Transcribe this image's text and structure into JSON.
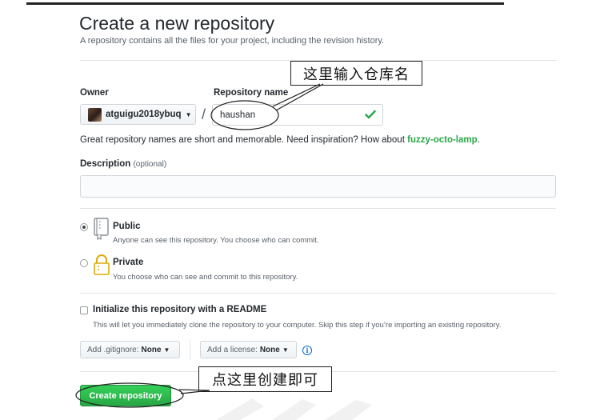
{
  "page": {
    "title": "Create a new repository",
    "subtitle": "A repository contains all the files for your project, including the revision history."
  },
  "owner": {
    "label": "Owner",
    "value": "atguigu2018ybuq"
  },
  "repo": {
    "label": "Repository name",
    "value": "haushan",
    "separator": "/"
  },
  "hint": {
    "text": "Great repository names are short and memorable. Need inspiration? How about ",
    "suggestion": "fuzzy-octo-lamp",
    "end": "."
  },
  "description": {
    "label": "Description",
    "optional": "(optional)",
    "value": ""
  },
  "visibility": {
    "public": {
      "title": "Public",
      "note": "Anyone can see this repository. You choose who can commit.",
      "selected": true
    },
    "private": {
      "title": "Private",
      "note": "You choose who can see and commit to this repository.",
      "selected": false
    }
  },
  "readme": {
    "title": "Initialize this repository with a README",
    "note": "This will let you immediately clone the repository to your computer. Skip this step if you’re importing an existing repository.",
    "checked": false
  },
  "gitignore": {
    "prefix": "Add .gitignore:",
    "value": "None"
  },
  "license": {
    "prefix": "Add a license:",
    "value": "None"
  },
  "submit": {
    "label": "Create repository"
  },
  "annotations": {
    "repo_name": "这里输入仓库名",
    "create": "点这里创建即可"
  },
  "colors": {
    "accent_green": "#28a745",
    "link_blue": "#0366d6",
    "check_green": "#28a745"
  },
  "icons": {
    "owner_dropdown": "caret-down-icon",
    "valid": "check-icon",
    "public": "repo-book-icon",
    "private": "lock-icon",
    "info": "info-icon"
  }
}
